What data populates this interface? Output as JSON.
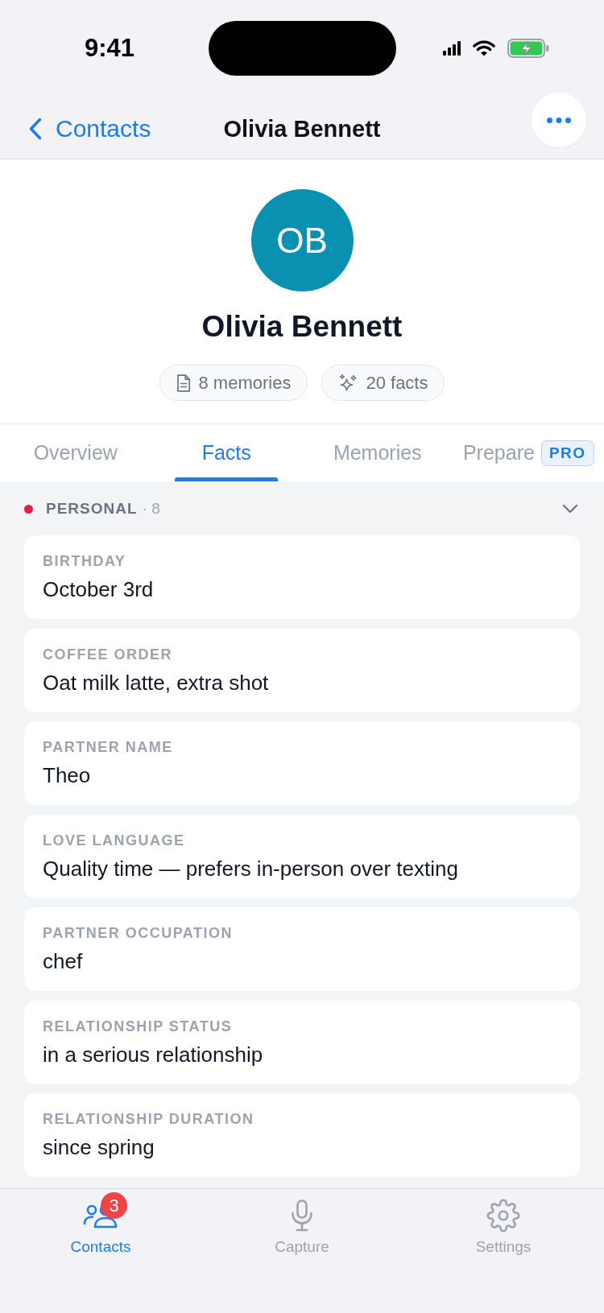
{
  "status_bar": {
    "time": "9:41"
  },
  "nav": {
    "back_label": "Contacts",
    "title": "Olivia Bennett"
  },
  "profile": {
    "initials": "OB",
    "name": "Olivia Bennett",
    "chips": [
      {
        "kind": "memories",
        "label": "8 memories"
      },
      {
        "kind": "facts",
        "label": "20 facts"
      }
    ]
  },
  "tabs": [
    {
      "label": "Overview",
      "selected": false
    },
    {
      "label": "Facts",
      "selected": true
    },
    {
      "label": "Memories",
      "selected": false
    },
    {
      "label": "Prepare",
      "selected": false,
      "badge": "PRO"
    }
  ],
  "sections": [
    {
      "title": "PERSONAL",
      "count": "· 8",
      "color": "#e11d48",
      "expanded": true,
      "facts": [
        {
          "label": "BIRTHDAY",
          "value": "October 3rd"
        },
        {
          "label": "COFFEE ORDER",
          "value": "Oat milk latte, extra shot"
        },
        {
          "label": "PARTNER NAME",
          "value": "Theo"
        },
        {
          "label": "LOVE LANGUAGE",
          "value": "Quality time — prefers in-person over texting"
        },
        {
          "label": "PARTNER OCCUPATION",
          "value": "chef"
        },
        {
          "label": "RELATIONSHIP STATUS",
          "value": "in a serious relationship"
        },
        {
          "label": "RELATIONSHIP DURATION",
          "value": "since spring"
        }
      ]
    }
  ],
  "tab_bar": [
    {
      "kind": "contacts",
      "label": "Contacts",
      "selected": true,
      "badge": "3"
    },
    {
      "kind": "capture",
      "label": "Capture",
      "selected": false
    },
    {
      "kind": "settings",
      "label": "Settings",
      "selected": false
    }
  ]
}
